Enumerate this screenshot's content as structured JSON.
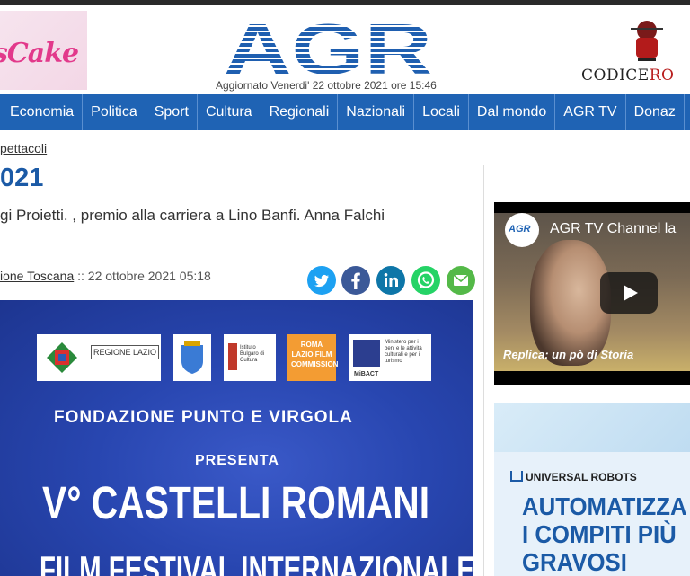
{
  "header": {
    "left_ad_text": "sCake",
    "site_logo": "AGR",
    "updated": "Aggiornato Venerdi' 22 ottobre 2021 ore 15:46",
    "right_ad_text_main": "CODICE",
    "right_ad_text_accent": "RO"
  },
  "nav": {
    "items": [
      "Economia",
      "Politica",
      "Sport",
      "Cultura",
      "Regionali",
      "Nazionali",
      "Locali",
      "Dal mondo",
      "AGR TV",
      "Donaz"
    ]
  },
  "article": {
    "breadcrumb": "pettacoli",
    "headline": "021",
    "subtitle": "gi Proietti. , premio alla carriera a Lino Banfi. Anna Falchi",
    "byline_source": "ione Toscana",
    "byline_date": " :: 22 ottobre 2021 05:18",
    "share_icons": [
      "twitter-icon",
      "facebook-icon",
      "linkedin-icon",
      "whatsapp-icon",
      "email-icon"
    ]
  },
  "poster": {
    "logo_regione": "REGIONE LAZIO",
    "logo_istituto": "Istituto Bulgaro di Cultura",
    "logo_roma_lazio": "ROMA LAZIO FILM COMMISSION",
    "logo_mibact": "MiBACT",
    "logo_ministero": "Ministero per i beni e le attività culturali e per il turismo",
    "line1": "FONDAZIONE PUNTO E VIRGOLA",
    "line2": "PRESENTA",
    "line3": "V° CASTELLI ROMANI",
    "line4": "FILM FESTIVAL INTERNAZIONALE"
  },
  "video": {
    "channel_logo": "AGR",
    "title": "AGR TV Channel la",
    "replica": "Replica: un pò di Storia"
  },
  "ad_ur": {
    "brand": "UNIVERSAL ROBOTS",
    "headline_1": "AUTOMATIZZA",
    "headline_2": "I COMPITI PIÙ",
    "headline_3": "GRAVOSI"
  },
  "colors": {
    "nav_bg": "#1f63b4",
    "headline": "#1b5aa6",
    "poster_bg": "#2846b0"
  }
}
